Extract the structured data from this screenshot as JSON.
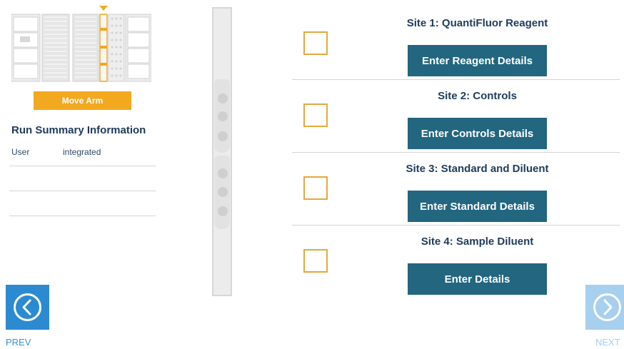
{
  "deck_map": {
    "move_arm_label": "Move Arm"
  },
  "run_summary": {
    "title": "Run Summary Information",
    "rows": [
      {
        "key": "User",
        "value": "integrated"
      },
      {
        "key": "",
        "value": ""
      },
      {
        "key": "",
        "value": ""
      }
    ]
  },
  "sites": [
    {
      "title": "Site 1: QuantiFluor Reagent",
      "button": "Enter Reagent Details",
      "checked": false
    },
    {
      "title": "Site 2: Controls",
      "button": "Enter Controls Details",
      "checked": false
    },
    {
      "title": "Site 3: Standard and Diluent",
      "button": "Enter Standard Details",
      "checked": false
    },
    {
      "title": "Site 4: Sample Diluent",
      "button": "Enter Details",
      "checked": false
    }
  ],
  "nav": {
    "prev_label": "PREV",
    "next_label": "NEXT"
  },
  "colors": {
    "accent_orange": "#f2a91f",
    "button_teal": "#226680",
    "nav_blue": "#2b8ad0",
    "nav_disabled": "#a7cfee"
  },
  "icons": {
    "prev": "chevron-left-circle-icon",
    "next": "chevron-right-circle-icon",
    "arm_marker": "triangle-down-icon"
  }
}
